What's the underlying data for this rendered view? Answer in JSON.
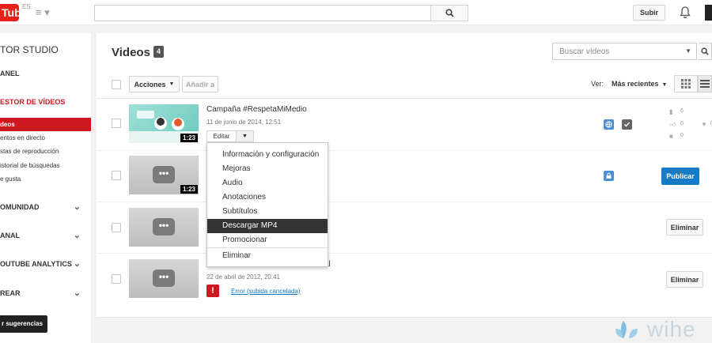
{
  "header": {
    "logo_text": "Tube",
    "logo_region": "ES",
    "search_placeholder": "",
    "upload_label": "Subir"
  },
  "sidebar": {
    "studio_title": "TOR STUDIO",
    "canal": "ANEL",
    "gestor": "ESTOR DE VÍDEOS",
    "items": [
      {
        "label": "deos"
      },
      {
        "label": "entos en directo"
      },
      {
        "label": "stas de reproducción"
      },
      {
        "label": "istorial de búsquedas"
      },
      {
        "label": "e gusta"
      }
    ],
    "sections": [
      {
        "label": "OMUNIDAD"
      },
      {
        "label": "ANAL"
      },
      {
        "label": "OUTUBE ANALYTICS"
      },
      {
        "label": "REAR"
      }
    ],
    "suggestions_label": "r sugerencias"
  },
  "main": {
    "title": "Videos",
    "count": "4",
    "search_placeholder": "Buscar vídeos",
    "actions_label": "Acciones",
    "add_to_label": "Añadir a",
    "view_label": "Ver:",
    "sort_label": "Más recientes",
    "videos": [
      {
        "title": "Campaña #RespetaMiMedio",
        "date": "11 de junio de 2014, 12:51",
        "duration": "1:23",
        "edit_label": "Editar",
        "stats": {
          "views": "6",
          "likes": "0",
          "dislikes": "0",
          "comments": "0"
        }
      },
      {
        "duration": "1:23",
        "action_label": "Publicar"
      },
      {
        "action_label": "Eliminar"
      },
      {
        "title_fragment": "al",
        "date": "22 de abril de 2012, 20:41",
        "error_label": "Error (subida cancelada)",
        "action_label": "Eliminar"
      }
    ],
    "edit_menu": [
      {
        "label": "Información y configuración"
      },
      {
        "label": "Mejoras"
      },
      {
        "label": "Audio"
      },
      {
        "label": "Anotaciones"
      },
      {
        "label": "Subtítulos"
      },
      {
        "label": "Descargar MP4"
      },
      {
        "label": "Promocionar"
      },
      {
        "label": "Eliminar"
      }
    ]
  },
  "watermark": "wihe",
  "colors": {
    "accent_red": "#cc181e",
    "brand_red": "#e62117",
    "link_blue": "#167ac6",
    "publish_blue": "#167ac6"
  }
}
